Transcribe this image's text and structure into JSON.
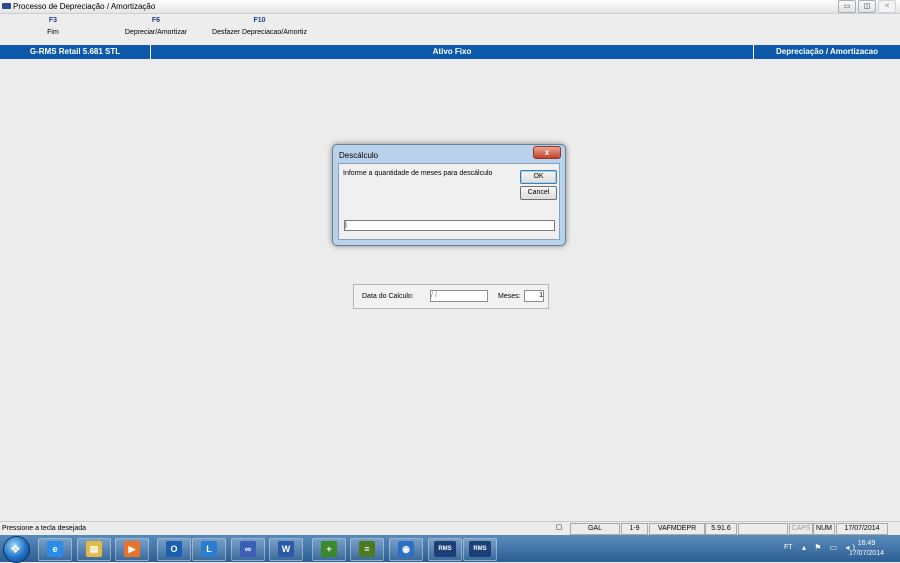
{
  "window": {
    "title": "Processo de Depreciação / Amortização",
    "buttons": [
      "▭",
      "◫",
      "✕"
    ]
  },
  "fkeys": [
    {
      "key": "F3",
      "label": "Fim"
    },
    {
      "key": "F6",
      "label": "Depreciar/Amortizar"
    },
    {
      "key": "F10",
      "label": "Desfazer Depreciacao/Amortiz"
    }
  ],
  "header": {
    "left": "G-RMS Retail 5.681 STL",
    "center": "Ativo Fixo",
    "right": "Depreciação / Amortizacao"
  },
  "dialog": {
    "title": "Descálculo",
    "close": "x",
    "prompt": "Informe a quantidade de meses para descálculo",
    "ok": "OK",
    "cancel": "Cancel",
    "input_value": "|"
  },
  "calc_form": {
    "date_label": "Data do Calculo:",
    "date_value": " / /",
    "months_label": "Meses:",
    "months_value": "1"
  },
  "statusbar": {
    "message": "Pressione a tecla desejada",
    "panes": [
      "GAL",
      "1-9",
      "VAFMDEPR",
      "5.91.6",
      "",
      "CAPS",
      "NUM",
      "17/07/2014"
    ]
  },
  "taskbar": {
    "start": "❖",
    "apps": [
      {
        "name": "internet-explorer-icon",
        "glyph": "e",
        "color": "#2a8ee8"
      },
      {
        "name": "file-explorer-icon",
        "glyph": "▤",
        "color": "#e6b84a"
      },
      {
        "name": "media-player-icon",
        "glyph": "▶",
        "color": "#e8732a"
      },
      {
        "name": "outlook-icon",
        "glyph": "O",
        "color": "#1b5fb0"
      },
      {
        "name": "lync-icon",
        "glyph": "L",
        "color": "#2a7dd1"
      },
      {
        "name": "infinity-app-icon",
        "glyph": "∞",
        "color": "#3b5fb8"
      },
      {
        "name": "word-icon",
        "glyph": "W",
        "color": "#2b5aa8"
      },
      {
        "name": "plus-app-icon",
        "glyph": "+",
        "color": "#3a8a2a"
      },
      {
        "name": "stack-app-icon",
        "glyph": "≡",
        "color": "#4a7a22"
      },
      {
        "name": "globe-app-icon",
        "glyph": "◉",
        "color": "#2a6fc2"
      },
      {
        "name": "rms-app-icon",
        "glyph": "RMS",
        "color": "#1c3f78"
      },
      {
        "name": "rms-app-icon-2",
        "glyph": "RMS",
        "color": "#1c3f78"
      }
    ],
    "tray": {
      "indicator": "FT",
      "icons": "▴ ⚑ ▭ ◂)",
      "time": "16:49",
      "date": "17/07/2014"
    }
  }
}
